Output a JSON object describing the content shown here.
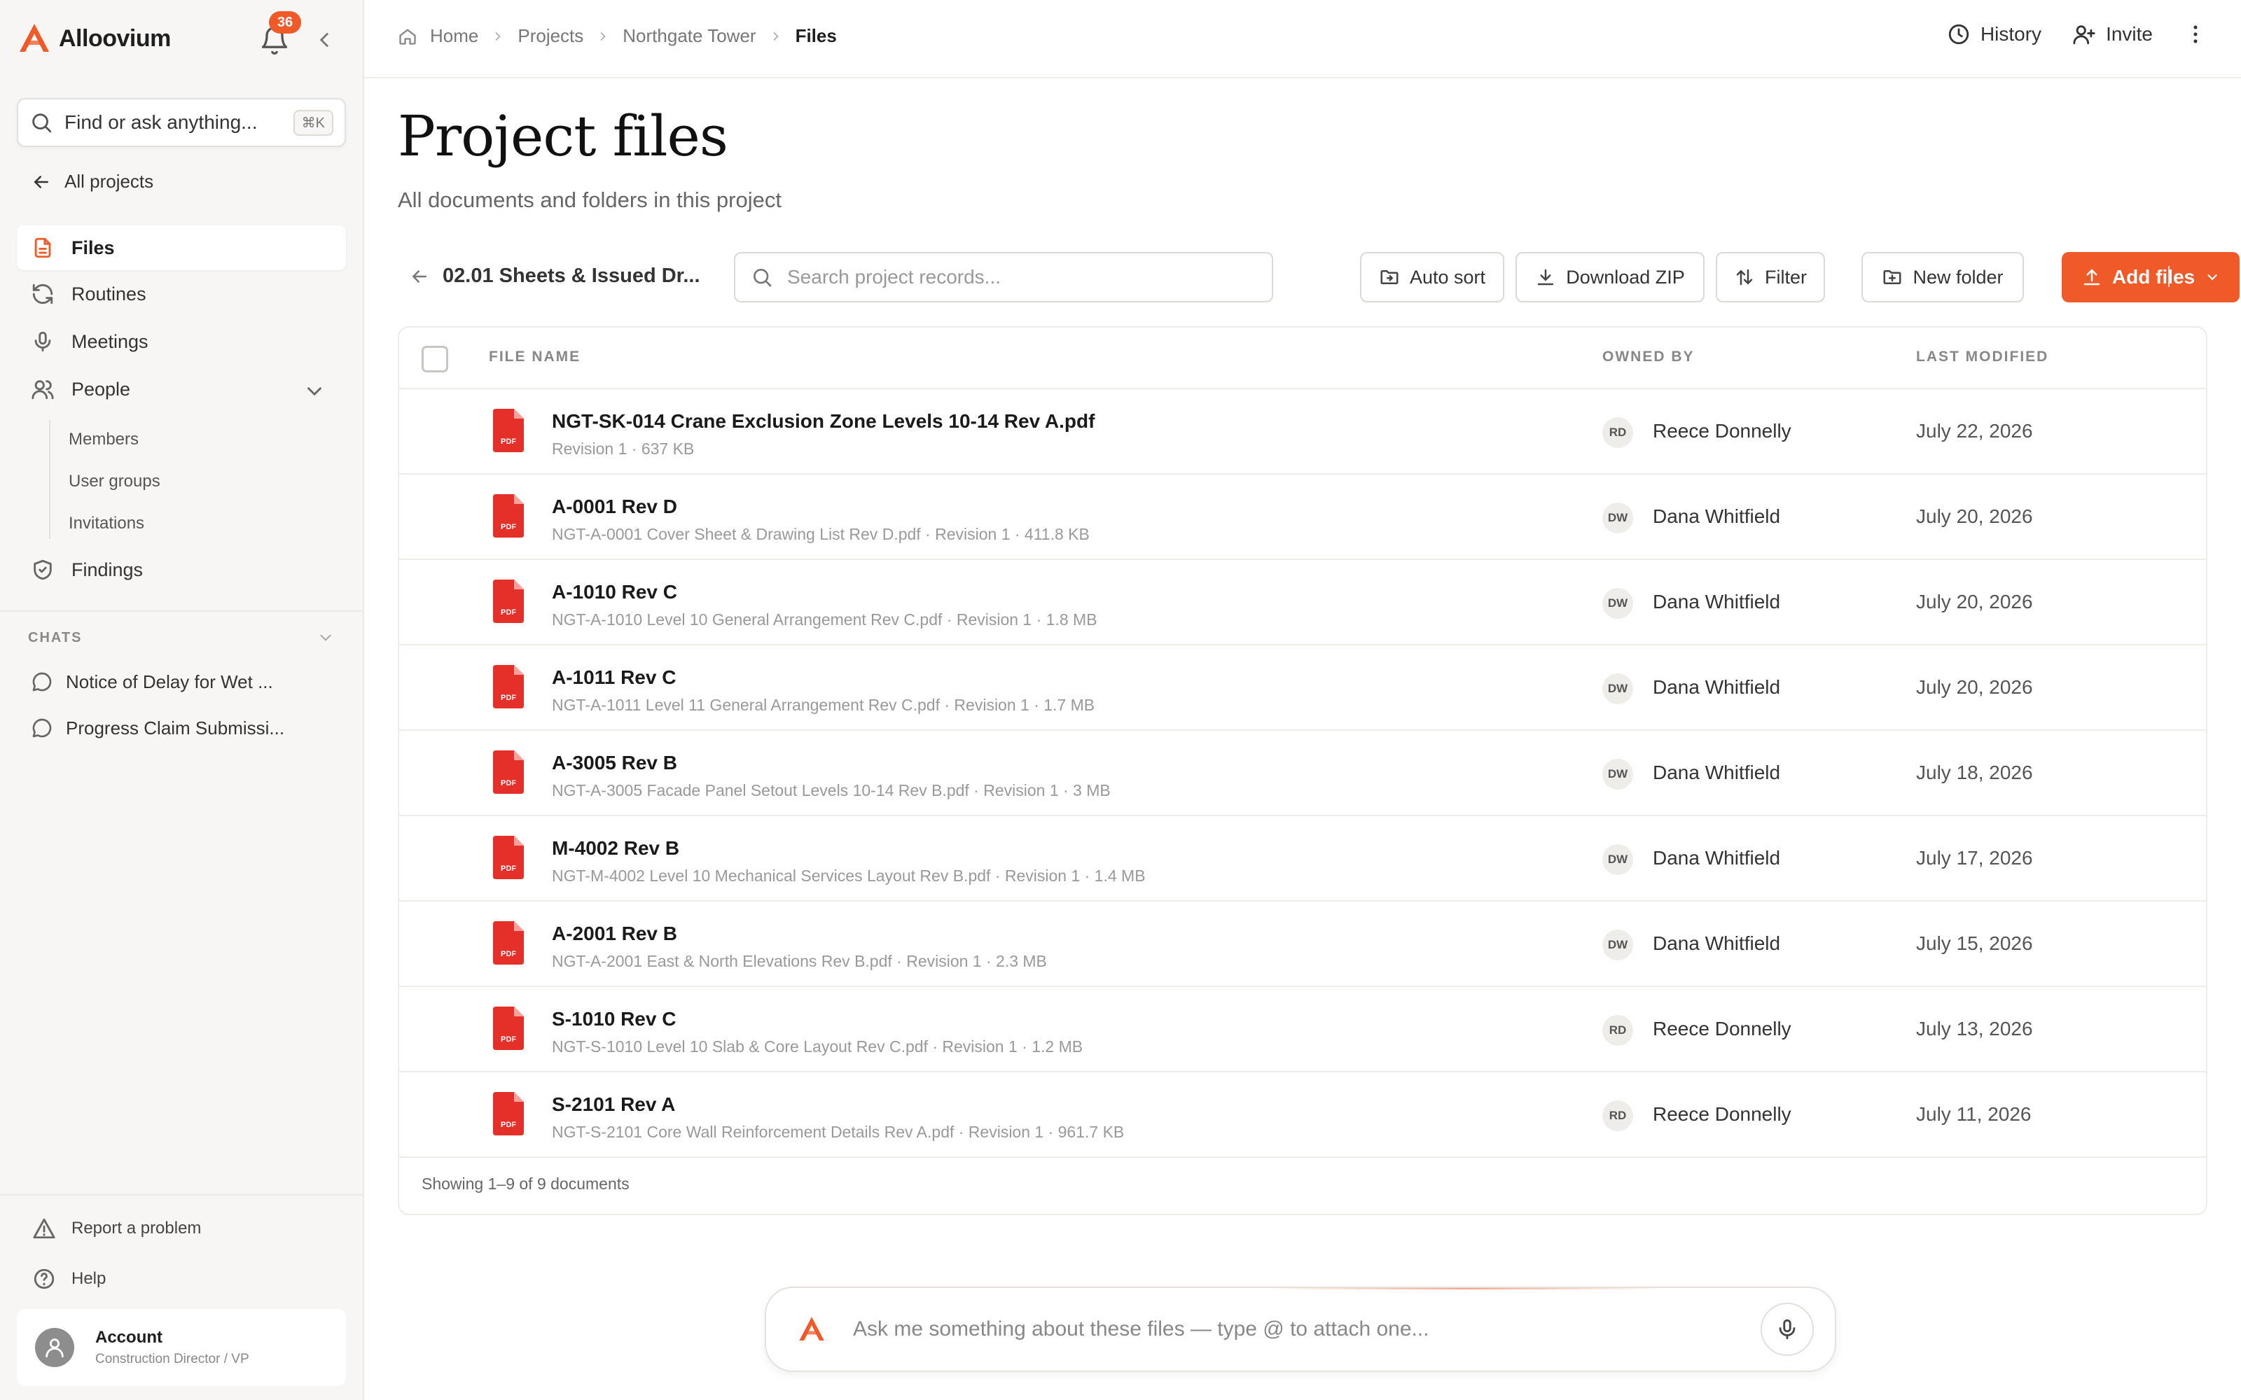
{
  "brand": {
    "name": "Alloovium",
    "accent": "#f05a28"
  },
  "notifications": {
    "count": "36"
  },
  "sidebar": {
    "search_placeholder": "Find or ask anything...",
    "search_shortcut": "⌘K",
    "back_label": "All projects",
    "nav": [
      {
        "label": "Files",
        "icon": "file-icon",
        "active": true
      },
      {
        "label": "Routines",
        "icon": "refresh-icon"
      },
      {
        "label": "Meetings",
        "icon": "microphone-icon"
      },
      {
        "label": "People",
        "icon": "users-icon"
      },
      {
        "label": "Findings",
        "icon": "shield-check-icon"
      }
    ],
    "people_sub": [
      "Members",
      "User groups",
      "Invitations"
    ],
    "chats_heading": "CHATS",
    "chats": [
      "Notice of Delay for Wet ...",
      "Progress Claim Submissi..."
    ],
    "footer": {
      "report": "Report a problem",
      "help": "Help"
    },
    "account": {
      "name": "Account",
      "role": "Construction Director / VP"
    }
  },
  "header": {
    "breadcrumbs": [
      "Home",
      "Projects",
      "Northgate Tower",
      "Files"
    ],
    "actions": {
      "history": "History",
      "invite": "Invite"
    }
  },
  "page": {
    "title": "Project files",
    "subtitle": "All documents and folders in this project"
  },
  "toolbar": {
    "folder_label": "02.01 Sheets & Issued Dr...",
    "search_placeholder": "Search project records...",
    "auto_sort": "Auto sort",
    "download_zip": "Download ZIP",
    "filter": "Filter",
    "new_folder": "New folder",
    "add_files": "Add files"
  },
  "table": {
    "columns": {
      "file_name": "FILE NAME",
      "owned_by": "OWNED BY",
      "last_modified": "LAST MODIFIED"
    },
    "rows": [
      {
        "name": "NGT-SK-014 Crane Exclusion Zone Levels 10-14 Rev A.pdf",
        "meta": "Revision 1 · 637 KB",
        "owner_initials": "RD",
        "owner": "Reece Donnelly",
        "modified": "July 22, 2026"
      },
      {
        "name": "A-0001 Rev D",
        "meta": "NGT-A-0001 Cover Sheet & Drawing List Rev D.pdf · Revision 1 · 411.8 KB",
        "owner_initials": "DW",
        "owner": "Dana Whitfield",
        "modified": "July 20, 2026"
      },
      {
        "name": "A-1010 Rev C",
        "meta": "NGT-A-1010 Level 10 General Arrangement Rev C.pdf · Revision 1 · 1.8 MB",
        "owner_initials": "DW",
        "owner": "Dana Whitfield",
        "modified": "July 20, 2026"
      },
      {
        "name": "A-1011 Rev C",
        "meta": "NGT-A-1011 Level 11 General Arrangement Rev C.pdf · Revision 1 · 1.7 MB",
        "owner_initials": "DW",
        "owner": "Dana Whitfield",
        "modified": "July 20, 2026"
      },
      {
        "name": "A-3005 Rev B",
        "meta": "NGT-A-3005 Facade Panel Setout Levels 10-14 Rev B.pdf · Revision 1 · 3 MB",
        "owner_initials": "DW",
        "owner": "Dana Whitfield",
        "modified": "July 18, 2026"
      },
      {
        "name": "M-4002 Rev B",
        "meta": "NGT-M-4002 Level 10 Mechanical Services Layout Rev B.pdf · Revision 1 · 1.4 MB",
        "owner_initials": "DW",
        "owner": "Dana Whitfield",
        "modified": "July 17, 2026"
      },
      {
        "name": "A-2001 Rev B",
        "meta": "NGT-A-2001 East & North Elevations Rev B.pdf · Revision 1 · 2.3 MB",
        "owner_initials": "DW",
        "owner": "Dana Whitfield",
        "modified": "July 15, 2026"
      },
      {
        "name": "S-1010 Rev C",
        "meta": "NGT-S-1010 Level 10 Slab & Core Layout Rev C.pdf · Revision 1 · 1.2 MB",
        "owner_initials": "RD",
        "owner": "Reece Donnelly",
        "modified": "July 13, 2026"
      },
      {
        "name": "S-2101 Rev A",
        "meta": "NGT-S-2101 Core Wall Reinforcement Details Rev A.pdf · Revision 1 · 961.7 KB",
        "owner_initials": "RD",
        "owner": "Reece Donnelly",
        "modified": "July 11, 2026"
      }
    ],
    "file_badge": "PDF",
    "footer": "Showing 1–9 of 9 documents"
  },
  "assistant": {
    "placeholder": "Ask me something about these files — type @ to attach one..."
  }
}
